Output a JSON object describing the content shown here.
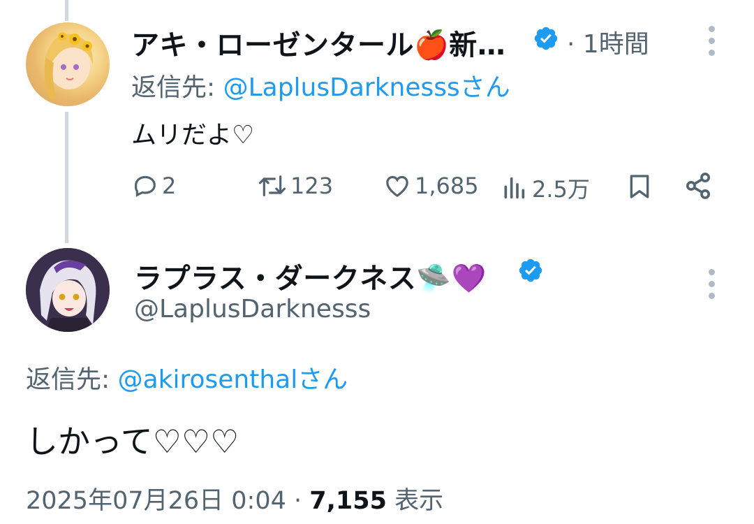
{
  "tweet1": {
    "display_name": "アキ・ローゼンタール🍎新…",
    "time": "1時間",
    "reply_prefix": "返信先: ",
    "reply_handle": "@LaplusDarknesssさん",
    "text": "ムリだよ♡",
    "actions": {
      "replies": "2",
      "retweets": "123",
      "likes": "1,685",
      "views": "2.5万"
    }
  },
  "tweet2": {
    "display_name": "ラプラス・ダークネス🛸💜",
    "handle": "@LaplusDarknesss",
    "reply_prefix": "返信先: ",
    "reply_handle": "@akirosenthalさん",
    "text": "しかって♡♡♡",
    "date": "2025年07月26日 0:04 · ",
    "view_count": "7,155",
    "view_label": " 表示"
  },
  "colors": {
    "accent": "#1d9bf0",
    "muted": "#536471",
    "thread_line": "#cfd9de"
  },
  "icons": [
    "verified-badge-icon",
    "more-options-icon",
    "reply-icon",
    "retweet-icon",
    "like-icon",
    "views-icon",
    "bookmark-icon",
    "share-icon"
  ]
}
